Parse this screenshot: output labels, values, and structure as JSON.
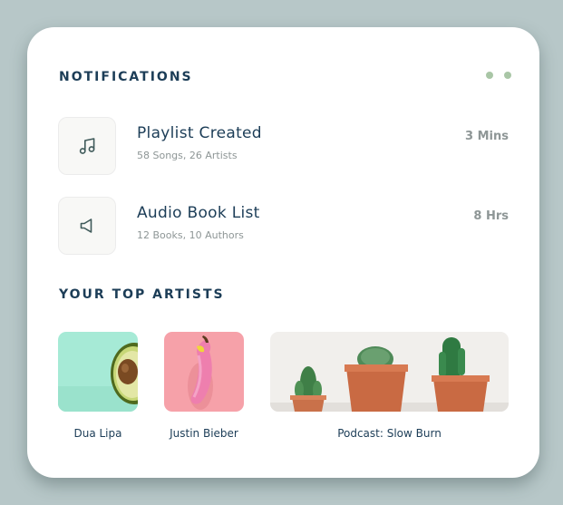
{
  "notifications": {
    "title": "NOTIFICATIONS",
    "menu_icon": "more-dots-icon",
    "items": [
      {
        "icon": "music-note-icon",
        "title": "Playlist Created",
        "subtitle": "58 Songs, 26 Artists",
        "time": "3 Mins"
      },
      {
        "icon": "speaker-icon",
        "title": "Audio Book List",
        "subtitle": "12 Books, 10 Authors",
        "time": "8 Hrs"
      }
    ]
  },
  "top_artists": {
    "title": "YOUR TOP ARTISTS",
    "items": [
      {
        "name": "Dua Lipa",
        "image": "avocado-on-mint-background"
      },
      {
        "name": "Justin Bieber",
        "image": "banana-on-pink-background"
      },
      {
        "name": "Podcast: Slow Burn",
        "image": "potted-cacti"
      }
    ]
  },
  "colors": {
    "background": "#b7c7c8",
    "card": "#ffffff",
    "heading": "#1c3d57",
    "muted": "#8e9696",
    "accent_dots": "#a9c6a6",
    "icon_box": "#f8f8f6"
  }
}
